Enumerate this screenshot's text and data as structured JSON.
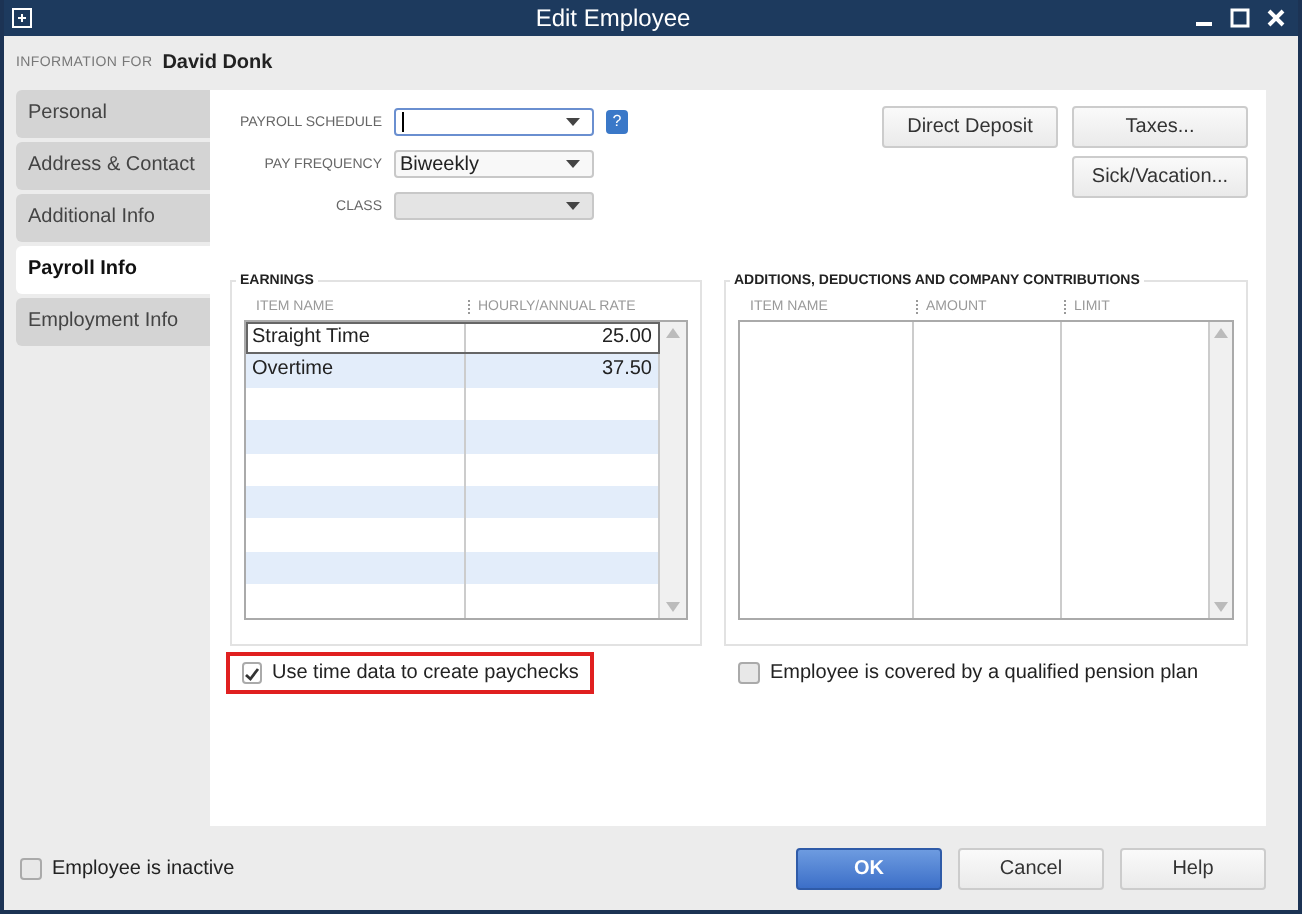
{
  "window": {
    "title": "Edit Employee"
  },
  "header": {
    "label": "INFORMATION FOR",
    "name": "David Donk"
  },
  "tabs": [
    {
      "label": "Personal",
      "selected": false
    },
    {
      "label": "Address & Contact",
      "selected": false
    },
    {
      "label": "Additional Info",
      "selected": false
    },
    {
      "label": "Payroll Info",
      "selected": true
    },
    {
      "label": "Employment Info",
      "selected": false
    }
  ],
  "fields": [
    {
      "label": "PAYROLL SCHEDULE",
      "focused": true,
      "disabled": false,
      "help": "?"
    },
    {
      "label": "PAY FREQUENCY",
      "value": "Biweekly",
      "focused": false,
      "disabled": false
    },
    {
      "label": "CLASS",
      "focused": false,
      "disabled": true
    }
  ],
  "top_buttons": [
    [
      "Direct Deposit",
      "Taxes..."
    ],
    [
      "Sick/Vacation..."
    ]
  ],
  "earnings": {
    "title": "EARNINGS",
    "columns": [
      "ITEM NAME",
      "HOURLY/ANNUAL RATE"
    ],
    "rows": [
      {
        "item": "Straight Time",
        "rate": "25.00",
        "selected": true
      },
      {
        "item": "Overtime",
        "rate": "37.50",
        "selected": false
      }
    ]
  },
  "additions": {
    "title": "ADDITIONS, DEDUCTIONS AND COMPANY CONTRIBUTIONS",
    "columns": [
      "ITEM NAME",
      "AMOUNT",
      "LIMIT"
    ]
  },
  "options": [
    {
      "label": "Use time data to create paychecks",
      "checked": true,
      "highlighted": true
    },
    {
      "label": "Employee is covered by a qualified pension plan",
      "checked": false,
      "highlighted": false
    }
  ],
  "inactive": {
    "label": "Employee is inactive",
    "checked": false
  },
  "footer_buttons": [
    {
      "label": "OK",
      "primary": true
    },
    {
      "label": "Cancel",
      "primary": false
    },
    {
      "label": "Help",
      "primary": false
    }
  ]
}
